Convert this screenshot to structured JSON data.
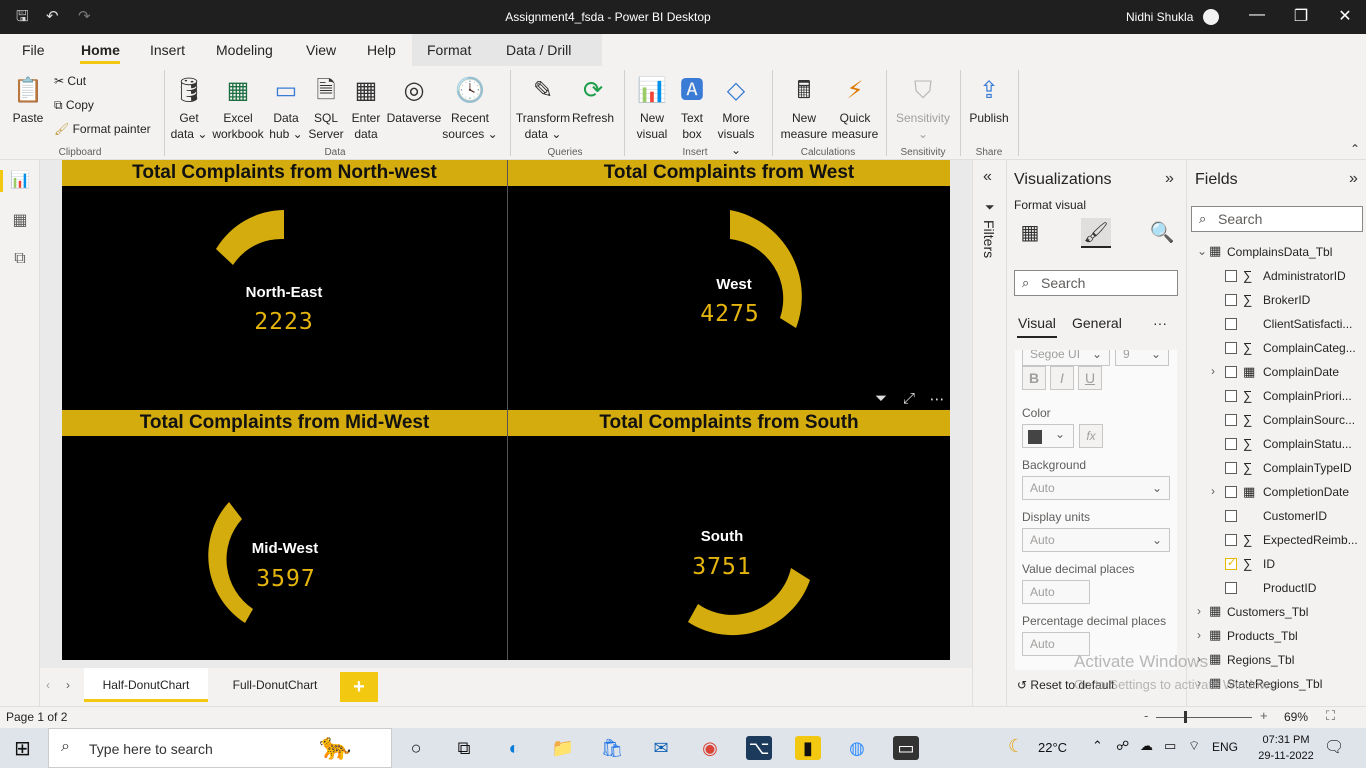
{
  "window": {
    "title": "Assignment4_fsda - Power BI Desktop",
    "user": "Nidhi Shukla"
  },
  "menu": {
    "file": "File",
    "home": "Home",
    "insert": "Insert",
    "modeling": "Modeling",
    "view": "View",
    "help": "Help",
    "format": "Format",
    "data_drill": "Data / Drill"
  },
  "ribbon": {
    "paste": "Paste",
    "cut": "Cut",
    "copy": "Copy",
    "format_painter": "Format painter",
    "clipboard_group": "Clipboard",
    "get_data": [
      "Get",
      "data"
    ],
    "excel_workbook": [
      "Excel",
      "workbook"
    ],
    "data_hub": [
      "Data",
      "hub"
    ],
    "sql_server": [
      "SQL",
      "Server"
    ],
    "enter_data": [
      "Enter",
      "data"
    ],
    "dataverse": "Dataverse",
    "recent_sources": [
      "Recent",
      "sources"
    ],
    "data_group": "Data",
    "transform_data": [
      "Transform",
      "data"
    ],
    "refresh": "Refresh",
    "queries_group": "Queries",
    "new_visual": [
      "New",
      "visual"
    ],
    "text_box": [
      "Text",
      "box"
    ],
    "more_visuals": [
      "More",
      "visuals"
    ],
    "insert_group": "Insert",
    "new_measure": [
      "New",
      "measure"
    ],
    "quick_measure": [
      "Quick",
      "measure"
    ],
    "calculations_group": "Calculations",
    "sensitivity": "Sensitivity",
    "sensitivity_group": "Sensitivity",
    "publish": "Publish",
    "share_group": "Share"
  },
  "canvas": {
    "tiles": [
      {
        "title": "Total Complaints from North-west",
        "label": "North-East",
        "value": "2223"
      },
      {
        "title": "Total Complaints from West",
        "label": "West",
        "value": "4275"
      },
      {
        "title": "Total Complaints from Mid-West",
        "label": "Mid-West",
        "value": "3597"
      },
      {
        "title": "Total Complaints from South",
        "label": "South",
        "value": "3751"
      }
    ],
    "accent": "#d4ac0d",
    "value_color": "#e5b50d"
  },
  "filters": {
    "label": "Filters"
  },
  "visualizations": {
    "title": "Visualizations",
    "subtitle": "Format visual",
    "search_placeholder": "Search",
    "tab_visual": "Visual",
    "tab_general": "General",
    "more": "···",
    "font_family": "Segoe UI",
    "font_size": "9",
    "bold": "B",
    "italic": "I",
    "underline": "U",
    "color_label": "Color",
    "fx": "fx",
    "background_label": "Background",
    "background_value": "Auto",
    "display_units_label": "Display units",
    "display_units_value": "Auto",
    "value_decimal_label": "Value decimal places",
    "value_decimal_value": "Auto",
    "percent_decimal_label": "Percentage decimal places",
    "percent_decimal_value": "Auto",
    "reset": "Reset to default"
  },
  "fields": {
    "title": "Fields",
    "search_placeholder": "Search",
    "tables": [
      {
        "name": "ComplainsData_Tbl",
        "expanded": true
      },
      {
        "name": "Customers_Tbl"
      },
      {
        "name": "Products_Tbl"
      },
      {
        "name": "Regions_Tbl"
      },
      {
        "name": "StateRegions_Tbl"
      }
    ],
    "columns": [
      {
        "name": "AdministratorID",
        "sigma": true,
        "checked": false
      },
      {
        "name": "BrokerID",
        "sigma": true,
        "checked": false
      },
      {
        "name": "ClientSatisfacti...",
        "sigma": false,
        "checked": false
      },
      {
        "name": "ComplainCateg...",
        "sigma": true,
        "checked": false
      },
      {
        "name": "ComplainDate",
        "sigma": false,
        "checked": false,
        "date": true
      },
      {
        "name": "ComplainPriori...",
        "sigma": true,
        "checked": false
      },
      {
        "name": "ComplainSourc...",
        "sigma": true,
        "checked": false
      },
      {
        "name": "ComplainStatu...",
        "sigma": true,
        "checked": false
      },
      {
        "name": "ComplainTypeID",
        "sigma": true,
        "checked": false
      },
      {
        "name": "CompletionDate",
        "sigma": false,
        "checked": false,
        "date": true
      },
      {
        "name": "CustomerID",
        "sigma": false,
        "checked": false
      },
      {
        "name": "ExpectedReimb...",
        "sigma": true,
        "checked": false
      },
      {
        "name": "ID",
        "sigma": true,
        "checked": true
      },
      {
        "name": "ProductID",
        "sigma": false,
        "checked": false
      }
    ],
    "watermark_1": "Activate Windows",
    "watermark_2": "Go to Settings to activate Windows."
  },
  "pages": {
    "tab1": "Half-DonutChart",
    "tab2": "Full-DonutChart",
    "add": "+"
  },
  "status": {
    "page": "Page 1 of 2",
    "zoom": "69%",
    "zoom_level": 0.69
  },
  "taskbar": {
    "search_placeholder": "Type here to search",
    "temperature": "22°C",
    "lang": "ENG",
    "time": "07:31 PM",
    "date": "29-11-2022"
  }
}
